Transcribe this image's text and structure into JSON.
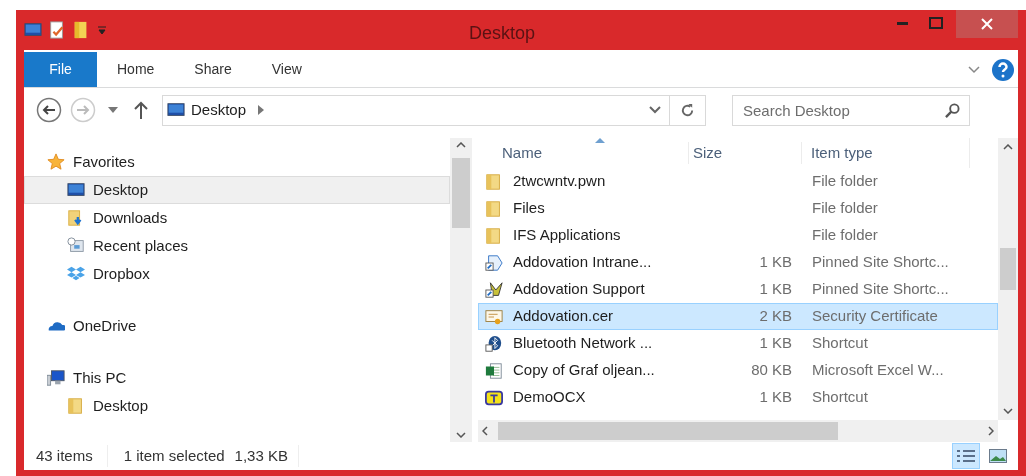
{
  "window": {
    "title": "Desktop"
  },
  "ribbon": {
    "tabs": [
      {
        "label": "File",
        "kind": "file"
      },
      {
        "label": "Home",
        "kind": "tab"
      },
      {
        "label": "Share",
        "kind": "tab"
      },
      {
        "label": "View",
        "kind": "tab"
      }
    ]
  },
  "address": {
    "path": "Desktop"
  },
  "search": {
    "placeholder": "Search Desktop"
  },
  "navigation": [
    {
      "label": "Favorites",
      "kind": "star",
      "selected": false,
      "children": [
        {
          "label": "Desktop",
          "kind": "desktop",
          "selected": true
        },
        {
          "label": "Downloads",
          "kind": "downloads",
          "selected": false
        },
        {
          "label": "Recent places",
          "kind": "recent",
          "selected": false
        },
        {
          "label": "Dropbox",
          "kind": "dropbox",
          "selected": false
        }
      ]
    },
    {
      "label": "OneDrive",
      "kind": "cloud",
      "selected": false
    },
    {
      "label": "This PC",
      "kind": "pc",
      "selected": false,
      "children": [
        {
          "label": "Desktop",
          "kind": "folder",
          "selected": false
        }
      ]
    }
  ],
  "files": {
    "columns": [
      "Name",
      "Size",
      "Item type"
    ],
    "rows": [
      {
        "name": "2twcwntv.pwn",
        "type": "File folder",
        "kind": "folder",
        "selected": false
      },
      {
        "name": "Files",
        "type": "File folder",
        "kind": "folder",
        "selected": false
      },
      {
        "name": "IFS Applications",
        "type": "File folder",
        "kind": "folder",
        "selected": false
      },
      {
        "name": "Addovation Intrane...",
        "size": "1 KB",
        "type": "Pinned Site Shortc...",
        "kind": "shortcut",
        "selected": false
      },
      {
        "name": "Addovation Support",
        "size": "1 KB",
        "type": "Pinned Site Shortc...",
        "kind": "support",
        "selected": false
      },
      {
        "name": "Addovation.cer",
        "size": "2 KB",
        "type": "Security Certificate",
        "kind": "certificate",
        "selected": true
      },
      {
        "name": "Bluetooth Network ...",
        "size": "1 KB",
        "type": "Shortcut",
        "kind": "bluetooth",
        "selected": false
      },
      {
        "name": "Copy of Graf oljean...",
        "size": "80 KB",
        "type": "Microsoft Excel W...",
        "kind": "excel",
        "selected": false
      },
      {
        "name": "DemoOCX",
        "size": "1 KB",
        "type": "Shortcut",
        "kind": "app",
        "selected": false
      }
    ]
  },
  "status_bar": {
    "count": "43 items",
    "selection": "1 item selected",
    "size": "1,33 KB"
  },
  "view_buttons": [
    {
      "kind": "details",
      "selected": true
    },
    {
      "kind": "tiles",
      "selected": false
    }
  ]
}
